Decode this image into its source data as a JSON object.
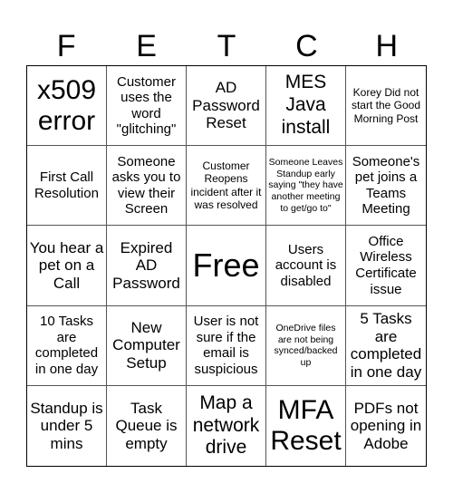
{
  "title_letters": [
    "F",
    "E",
    "T",
    "C",
    "H"
  ],
  "board": {
    "rows": [
      [
        {
          "text": "x509 error",
          "size": "fs-xl"
        },
        {
          "text": "Customer uses the word \"glitching\"",
          "size": "fs-s"
        },
        {
          "text": "AD Password Reset",
          "size": "fs-m"
        },
        {
          "text": "MES Java install",
          "size": "fs-l"
        },
        {
          "text": "Korey Did not start the Good Morning Post",
          "size": "fs-xs"
        }
      ],
      [
        {
          "text": "First Call Resolution",
          "size": "fs-s"
        },
        {
          "text": "Someone asks you to view their Screen",
          "size": "fs-s"
        },
        {
          "text": "Customer Reopens incident after it was resolved",
          "size": "fs-xs"
        },
        {
          "text": "Someone Leaves Standup early saying \"they have another meeting to get/go to\"",
          "size": "fs-xxs"
        },
        {
          "text": "Someone's pet joins a Teams Meeting",
          "size": "fs-s"
        }
      ],
      [
        {
          "text": "You hear a pet on a Call",
          "size": "fs-m"
        },
        {
          "text": "Expired AD Password",
          "size": "fs-m"
        },
        {
          "text": "Free",
          "size": "fs-free"
        },
        {
          "text": "Users account is disabled",
          "size": "fs-s"
        },
        {
          "text": "Office Wireless Certificate issue",
          "size": "fs-s"
        }
      ],
      [
        {
          "text": "10 Tasks are completed in one day",
          "size": "fs-s"
        },
        {
          "text": "New Computer Setup",
          "size": "fs-m"
        },
        {
          "text": "User is not sure if the email is suspicious",
          "size": "fs-s"
        },
        {
          "text": "OneDrive files are not being synced/backed up",
          "size": "fs-xxs"
        },
        {
          "text": "5 Tasks are completed in one day",
          "size": "fs-m"
        }
      ],
      [
        {
          "text": "Standup is under 5 mins",
          "size": "fs-m"
        },
        {
          "text": "Task Queue is empty",
          "size": "fs-m"
        },
        {
          "text": "Map a network drive",
          "size": "fs-l"
        },
        {
          "text": "MFA Reset",
          "size": "fs-xl"
        },
        {
          "text": "PDFs not opening in Adobe",
          "size": "fs-m"
        }
      ]
    ]
  }
}
